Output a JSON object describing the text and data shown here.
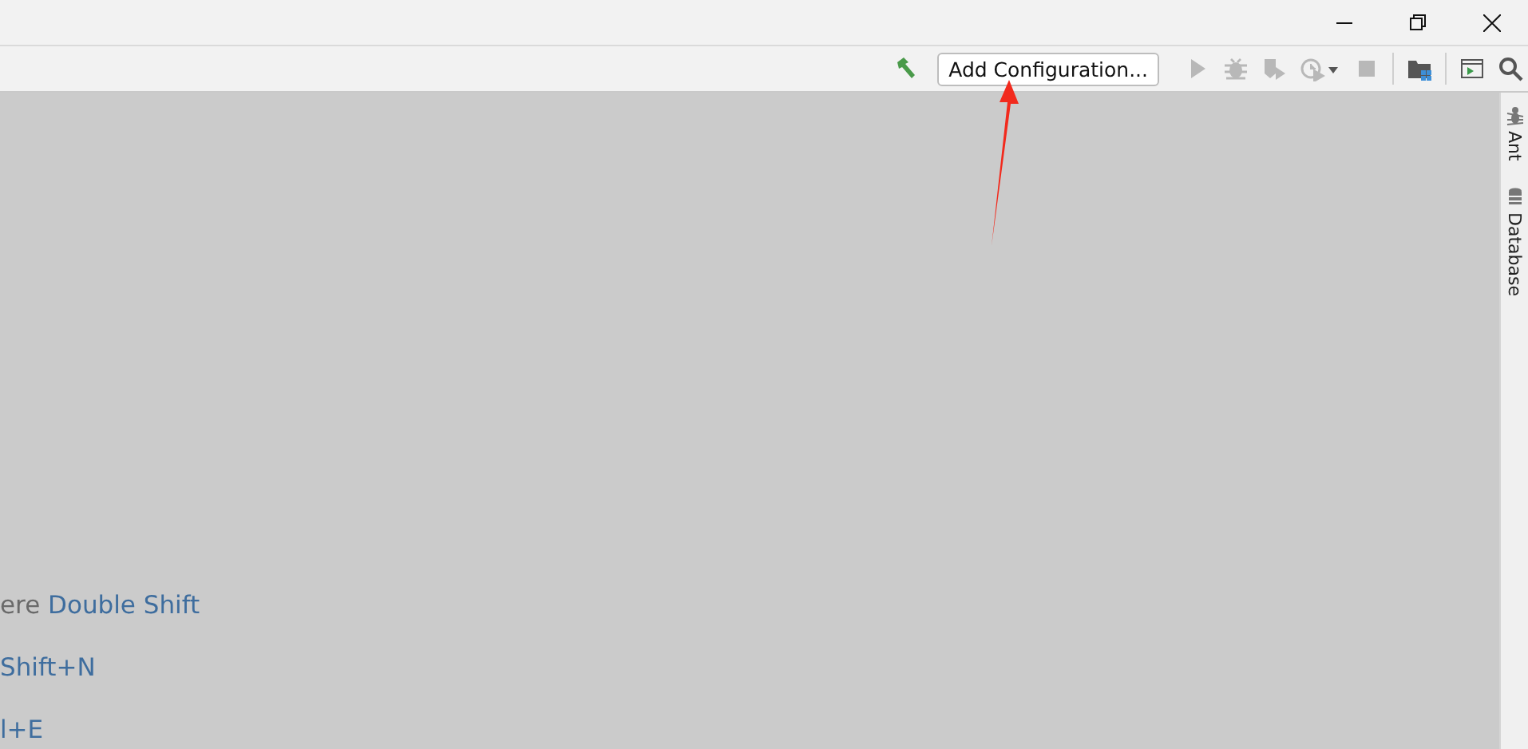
{
  "toolbar": {
    "config_button": "Add Configuration...",
    "tools": [
      {
        "kind": "build",
        "disabled": false
      },
      {
        "kind": "config"
      },
      {
        "kind": "run",
        "disabled": true
      },
      {
        "kind": "debug",
        "disabled": true
      },
      {
        "kind": "coverage",
        "disabled": true
      },
      {
        "kind": "profile",
        "disabled": true
      },
      {
        "kind": "stop",
        "disabled": true
      },
      {
        "kind": "separator"
      },
      {
        "kind": "structure",
        "disabled": false
      },
      {
        "kind": "separator"
      },
      {
        "kind": "terminal",
        "disabled": false
      },
      {
        "kind": "search",
        "disabled": false
      }
    ]
  },
  "right_sidebar": [
    {
      "kind": "ant",
      "label": "Ant"
    },
    {
      "kind": "database",
      "label": "Database"
    }
  ],
  "hints": [
    {
      "text": "ere ",
      "shortcut": "Double Shift"
    },
    {
      "shortcut": "Shift+N"
    },
    {
      "shortcut": "l+E"
    }
  ]
}
